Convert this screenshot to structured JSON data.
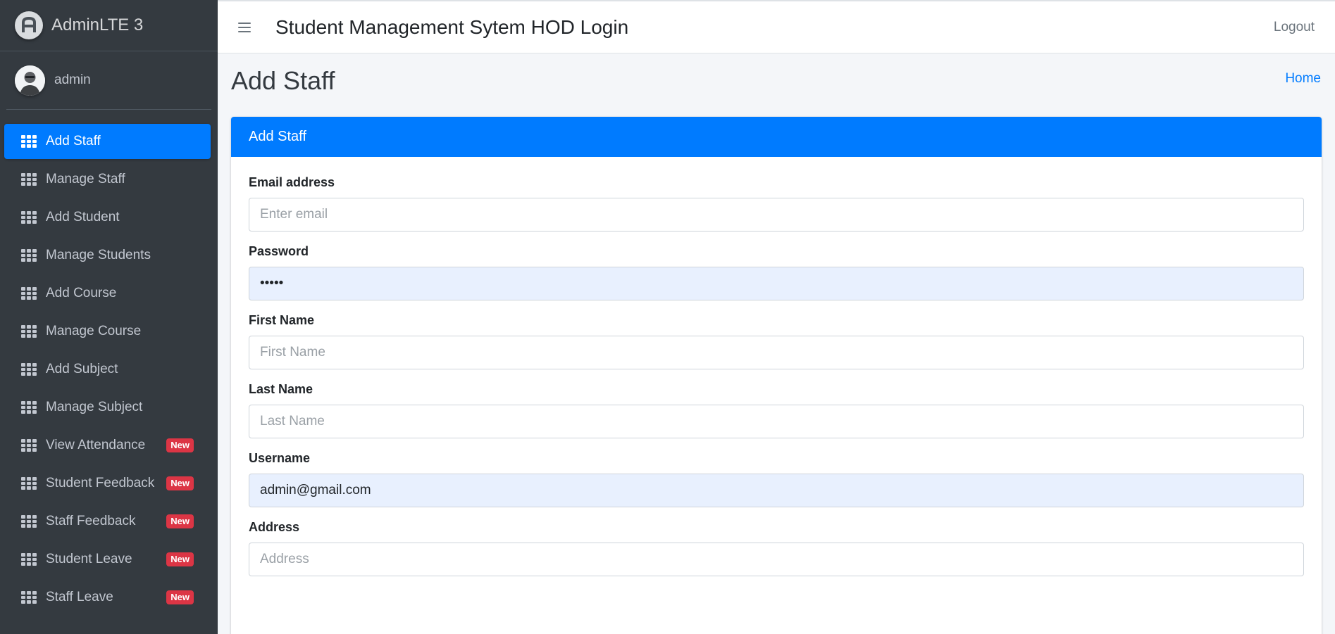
{
  "brand": {
    "name": "AdminLTE 3"
  },
  "user": {
    "name": "admin"
  },
  "sidebar": {
    "items": [
      {
        "label": "Add Staff",
        "active": true,
        "badge": ""
      },
      {
        "label": "Manage Staff",
        "active": false,
        "badge": ""
      },
      {
        "label": "Add Student",
        "active": false,
        "badge": ""
      },
      {
        "label": "Manage Students",
        "active": false,
        "badge": ""
      },
      {
        "label": "Add Course",
        "active": false,
        "badge": ""
      },
      {
        "label": "Manage Course",
        "active": false,
        "badge": ""
      },
      {
        "label": "Add Subject",
        "active": false,
        "badge": ""
      },
      {
        "label": "Manage Subject",
        "active": false,
        "badge": ""
      },
      {
        "label": "View Attendance",
        "active": false,
        "badge": "New"
      },
      {
        "label": "Student Feedback",
        "active": false,
        "badge": "New"
      },
      {
        "label": "Staff Feedback",
        "active": false,
        "badge": "New"
      },
      {
        "label": "Student Leave",
        "active": false,
        "badge": "New"
      },
      {
        "label": "Staff Leave",
        "active": false,
        "badge": "New"
      }
    ]
  },
  "topbar": {
    "title": "Student Management Sytem HOD Login",
    "logout_label": "Logout"
  },
  "page": {
    "title": "Add Staff",
    "breadcrumb_home": "Home"
  },
  "card": {
    "header": "Add Staff"
  },
  "form": {
    "email": {
      "label": "Email address",
      "placeholder": "Enter email",
      "value": ""
    },
    "password": {
      "label": "Password",
      "placeholder": "",
      "value": "•••••"
    },
    "first_name": {
      "label": "First Name",
      "placeholder": "First Name",
      "value": ""
    },
    "last_name": {
      "label": "Last Name",
      "placeholder": "Last Name",
      "value": ""
    },
    "username": {
      "label": "Username",
      "placeholder": "",
      "value": "admin@gmail.com"
    },
    "address": {
      "label": "Address",
      "placeholder": "Address",
      "value": ""
    }
  },
  "colors": {
    "primary": "#007bff",
    "sidebar_bg": "#343a40",
    "badge_danger": "#dc3545",
    "autofill_bg": "#e8f0fe"
  },
  "icons": {
    "menu": "hamburger-icon",
    "nav": "grid-icon",
    "brand": "adminlte-logo-icon"
  }
}
